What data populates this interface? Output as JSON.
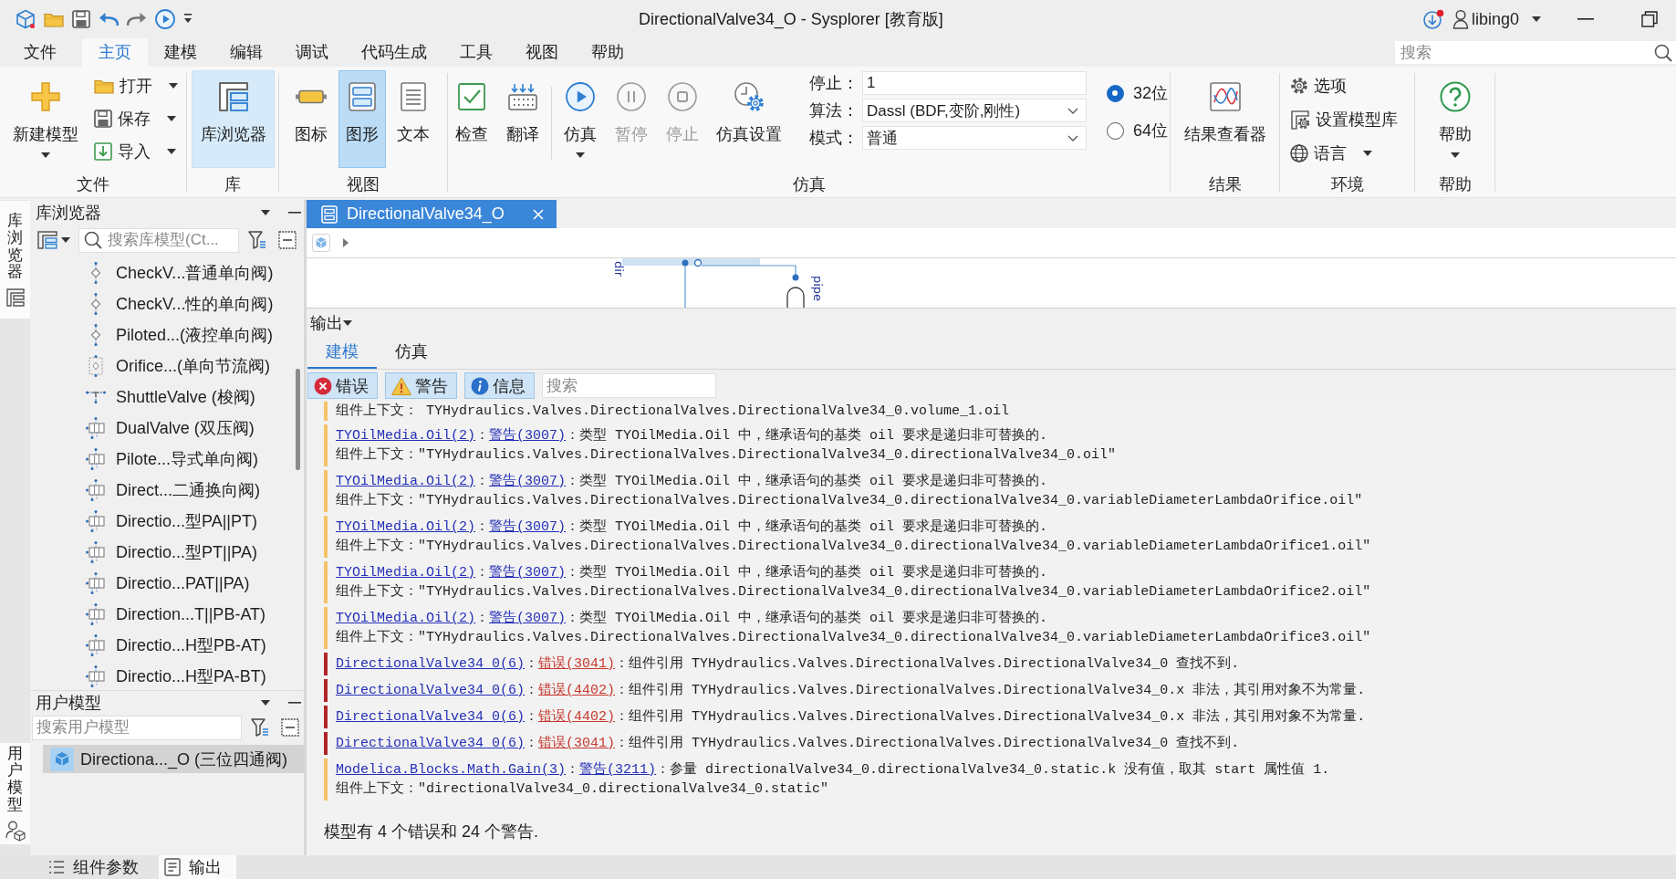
{
  "title_bar": {
    "title": "DirectionalValve34_O - Sysplorer [教育版]",
    "user": "libing0"
  },
  "menu": {
    "items": [
      {
        "label": "文件",
        "selected": false
      },
      {
        "label": "主页",
        "selected": true
      },
      {
        "label": "建模",
        "selected": false
      },
      {
        "label": "编辑",
        "selected": false
      },
      {
        "label": "调试",
        "selected": false
      },
      {
        "label": "代码生成",
        "selected": false
      },
      {
        "label": "工具",
        "selected": false
      },
      {
        "label": "视图",
        "selected": false
      },
      {
        "label": "帮助",
        "selected": false
      }
    ],
    "search": {
      "placeholder": "搜索"
    }
  },
  "ribbon": {
    "file": {
      "label": "文件",
      "new_model": {
        "label": "新建模型",
        "has_menu": true
      },
      "buttons": [
        {
          "label": "打开",
          "has_menu": true
        },
        {
          "label": "保存",
          "has_menu": true
        },
        {
          "label": "导入",
          "has_menu": true
        }
      ]
    },
    "library": {
      "label": "库",
      "button": {
        "label": "库浏览器",
        "selected": true
      }
    },
    "view": {
      "label": "视图",
      "buttons": [
        {
          "label": "图标",
          "selected": false
        },
        {
          "label": "图形",
          "selected": true
        },
        {
          "label": "文本",
          "selected": false
        }
      ]
    },
    "simulation": {
      "label": "仿真",
      "buttons": [
        {
          "label": "检查",
          "disabled": false,
          "has_menu": false
        },
        {
          "label": "翻译",
          "disabled": false,
          "has_menu": false
        },
        {
          "label": "仿真",
          "disabled": false,
          "has_menu": true
        },
        {
          "label": "暂停",
          "disabled": true,
          "has_menu": false
        },
        {
          "label": "停止",
          "disabled": true,
          "has_menu": false
        },
        {
          "label": "仿真设置",
          "disabled": false,
          "has_menu": false
        }
      ],
      "fields": [
        {
          "kind": "text",
          "label": "停止：",
          "value": "1"
        },
        {
          "kind": "dropdown",
          "label": "算法：",
          "value": "Dassl (BDF,变阶,刚性)"
        },
        {
          "kind": "dropdown",
          "label": "模式：",
          "value": "普通"
        }
      ],
      "radios": [
        {
          "label": "32位",
          "selected": true
        },
        {
          "label": "64位",
          "selected": false
        }
      ]
    },
    "results": {
      "label": "结果",
      "button": {
        "label": "结果查看器"
      }
    },
    "environment": {
      "label": "环境",
      "buttons": [
        {
          "label": "选项",
          "has_menu": false
        },
        {
          "label": "设置模型库",
          "has_menu": false
        },
        {
          "label": "语言",
          "has_menu": true
        }
      ]
    },
    "help": {
      "label": "帮助",
      "button": {
        "label": "帮助",
        "has_menu": true
      }
    }
  },
  "side_tabs": [
    {
      "label": "库浏览器",
      "selected": true
    },
    {
      "label": "用户模型",
      "selected": true
    }
  ],
  "library_browser": {
    "title": "库浏览器",
    "search": {
      "placeholder": "搜索库模型(Ct..."
    },
    "items": [
      {
        "label": "CheckV...普通单向阀)",
        "selected": false
      },
      {
        "label": "CheckV...性的单向阀)",
        "selected": false
      },
      {
        "label": "Piloted...(液控单向阀)",
        "selected": false
      },
      {
        "label": "Orifice...(单向节流阀)",
        "selected": false
      },
      {
        "label": "ShuttleValve (梭阀)",
        "selected": false
      },
      {
        "label": "DualValve (双压阀)",
        "selected": false
      },
      {
        "label": "Pilote...导式单向阀)",
        "selected": false
      },
      {
        "label": "Direct...二通换向阀)",
        "selected": false
      },
      {
        "label": "Directio...型PA||PT)",
        "selected": false
      },
      {
        "label": "Directio...型PT||PA)",
        "selected": false
      },
      {
        "label": "Directio...PAT||PA)",
        "selected": false
      },
      {
        "label": "Direction...T||PB-AT)",
        "selected": false
      },
      {
        "label": "Directio...H型PB-AT)",
        "selected": false
      },
      {
        "label": "Directio...H型PA-BT)",
        "selected": false
      }
    ]
  },
  "user_models": {
    "title": "用户模型",
    "search": {
      "placeholder": "搜索用户模型"
    },
    "items": [
      {
        "label": "Directiona..._O (三位四通阀)",
        "selected": true
      }
    ]
  },
  "document_tabs": [
    {
      "label": "DirectionalValve34_O",
      "selected": true
    }
  ],
  "diagram": {
    "labels": [
      "dir",
      "pipe"
    ]
  },
  "output": {
    "title": "输出",
    "tabs": [
      {
        "label": "建模",
        "selected": true
      },
      {
        "label": "仿真",
        "selected": false
      }
    ],
    "filters": [
      {
        "kind": "error",
        "label": "错误",
        "on": true
      },
      {
        "kind": "warning",
        "label": "警告",
        "on": true
      },
      {
        "kind": "info",
        "label": "信息",
        "on": true
      }
    ],
    "search": {
      "placeholder": "搜索"
    },
    "messages": [
      {
        "kind": "warning",
        "context": "组件上下文： TYHydraulics.Valves.DirectionalValves.DirectionalValve34_0.volume_1.oil"
      },
      {
        "kind": "warning",
        "source": "TYOilMedia.Oil(2)",
        "separator": "：",
        "code": "警告(3007)",
        "text": "：类型 TYOilMedia.Oil 中，继承语句的基类 oil 要求是递归非可替换的.",
        "context": "组件上下文：\"TYHydraulics.Valves.DirectionalValves.DirectionalValve34_0.directionalValve34_0.oil\""
      },
      {
        "kind": "warning",
        "source": "TYOilMedia.Oil(2)",
        "separator": "：",
        "code": "警告(3007)",
        "text": "：类型 TYOilMedia.Oil 中，继承语句的基类 oil 要求是递归非可替换的.",
        "context": "组件上下文：\"TYHydraulics.Valves.DirectionalValves.DirectionalValve34_0.directionalValve34_0.variableDiameterLambdaOrifice.oil\""
      },
      {
        "kind": "warning",
        "source": "TYOilMedia.Oil(2)",
        "separator": "：",
        "code": "警告(3007)",
        "text": "：类型 TYOilMedia.Oil 中，继承语句的基类 oil 要求是递归非可替换的.",
        "context": "组件上下文：\"TYHydraulics.Valves.DirectionalValves.DirectionalValve34_0.directionalValve34_0.variableDiameterLambdaOrifice1.oil\""
      },
      {
        "kind": "warning",
        "source": "TYOilMedia.Oil(2)",
        "separator": "：",
        "code": "警告(3007)",
        "text": "：类型 TYOilMedia.Oil 中，继承语句的基类 oil 要求是递归非可替换的.",
        "context": "组件上下文：\"TYHydraulics.Valves.DirectionalValves.DirectionalValve34_0.directionalValve34_0.variableDiameterLambdaOrifice2.oil\""
      },
      {
        "kind": "warning",
        "source": "TYOilMedia.Oil(2)",
        "separator": "：",
        "code": "警告(3007)",
        "text": "：类型 TYOilMedia.Oil 中，继承语句的基类 oil 要求是递归非可替换的.",
        "context": "组件上下文：\"TYHydraulics.Valves.DirectionalValves.DirectionalValve34_0.directionalValve34_0.variableDiameterLambdaOrifice3.oil\""
      },
      {
        "kind": "error",
        "source": "DirectionalValve34_0(6)",
        "separator": "：",
        "code": "错误(3041)",
        "text": "：组件引用 TYHydraulics.Valves.DirectionalValves.DirectionalValve34_0 查找不到."
      },
      {
        "kind": "error",
        "source": "DirectionalValve34_0(6)",
        "separator": "：",
        "code": "错误(4402)",
        "text": "：组件引用 TYHydraulics.Valves.DirectionalValves.DirectionalValve34_0.x 非法，其引用对象不为常量."
      },
      {
        "kind": "error",
        "source": "DirectionalValve34_0(6)",
        "separator": "：",
        "code": "错误(4402)",
        "text": "：组件引用 TYHydraulics.Valves.DirectionalValves.DirectionalValve34_0.x 非法，其引用对象不为常量."
      },
      {
        "kind": "error",
        "source": "DirectionalValve34_0(6)",
        "separator": "：",
        "code": "错误(3041)",
        "text": "：组件引用 TYHydraulics.Valves.DirectionalValves.DirectionalValve34_0 查找不到."
      },
      {
        "kind": "warning",
        "source": "Modelica.Blocks.Math.Gain(3)",
        "separator": "：",
        "code": "警告(3211)",
        "text": "：参量 directionalValve34_0.directionalValve34_0.static.k 没有值，取其 start 属性值 1.",
        "context": "组件上下文：\"directionalValve34_0.directionalValve34_0.static\""
      }
    ],
    "summary": "模型有 4 个错误和 24 个警告."
  },
  "bottom_tabs": [
    {
      "label": "组件参数",
      "selected": false
    },
    {
      "label": "输出",
      "selected": true
    }
  ]
}
